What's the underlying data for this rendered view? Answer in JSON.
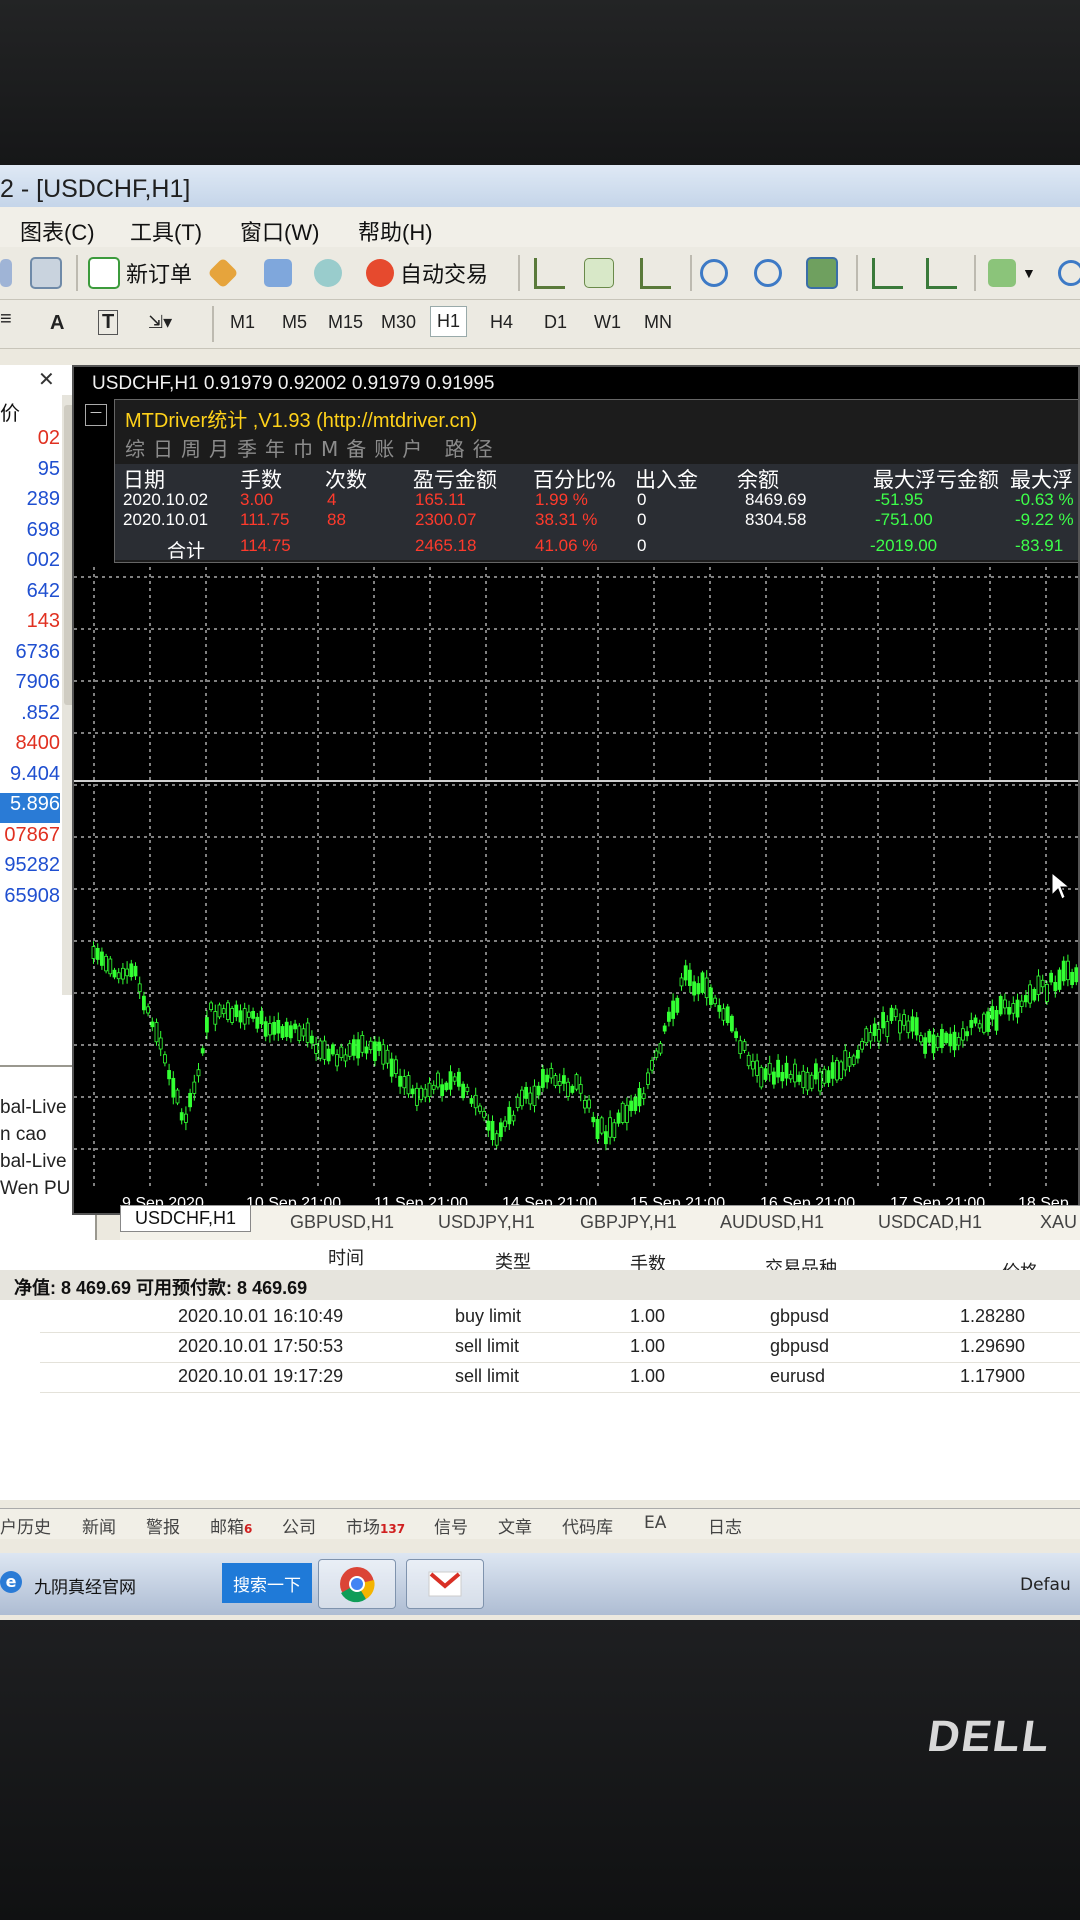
{
  "window": {
    "title": "2 - [USDCHF,H1]"
  },
  "menu": [
    "图表(C)",
    "工具(T)",
    "窗口(W)",
    "帮助(H)"
  ],
  "toolbar": {
    "new_order": "新订单",
    "auto_trade": "自动交易"
  },
  "timeframes": [
    "M1",
    "M5",
    "M15",
    "M30",
    "H1",
    "H4",
    "D1",
    "W1",
    "MN"
  ],
  "timeframe_selected": "H1",
  "market_watch": {
    "header": "价",
    "prices": [
      {
        "v": "02",
        "color": "#e03020"
      },
      {
        "v": "95",
        "color": "#1f4fd0"
      },
      {
        "v": "289",
        "color": "#1f4fd0"
      },
      {
        "v": "698",
        "color": "#1f4fd0"
      },
      {
        "v": "002",
        "color": "#1f4fd0"
      },
      {
        "v": "642",
        "color": "#1f4fd0"
      },
      {
        "v": "143",
        "color": "#e03020"
      },
      {
        "v": "6736",
        "color": "#1f4fd0"
      },
      {
        "v": "7906",
        "color": "#1f4fd0"
      },
      {
        "v": ".852",
        "color": "#1f4fd0"
      },
      {
        "v": "8400",
        "color": "#e03020"
      },
      {
        "v": "9.404",
        "color": "#1f4fd0"
      },
      {
        "v": "5.896",
        "color": "#ffffff"
      },
      {
        "v": "07867",
        "color": "#e03020"
      },
      {
        "v": "95282",
        "color": "#1f4fd0"
      },
      {
        "v": "65908",
        "color": "#1f4fd0"
      }
    ]
  },
  "navigator": {
    "items": [
      "bal-Live",
      "n cao",
      "bal-Live",
      "Wen PU"
    ]
  },
  "chart": {
    "header": "USDCHF,H1  0.91979 0.92002 0.91979 0.91995",
    "x_labels": [
      "9 Sep 2020",
      "10 Sep 21:00",
      "11 Sep 21:00",
      "14 Sep 21:00",
      "15 Sep 21:00",
      "16 Sep 21:00",
      "17 Sep 21:00",
      "18 Sep"
    ],
    "candle_color": "#33ff33",
    "grid_color": "#ffffff"
  },
  "stats": {
    "title": "MTDriver统计 ,V1.93 (http://mtdriver.cn)",
    "tabs": "综日周月季年巾M备账户 路径",
    "headers": [
      "日期",
      "手数",
      "次数",
      "盈亏金额",
      "百分比%",
      "出入金",
      "余额",
      "最大浮亏金额",
      "最大浮"
    ],
    "rows": [
      {
        "date": "2020.10.02",
        "lots": "3.00",
        "count": "4",
        "pnl": "165.11",
        "pct": "1.99 %",
        "io": "0",
        "balance": "8469.69",
        "maxloss": "-51.95",
        "maxpct": "-0.63 %"
      },
      {
        "date": "2020.10.01",
        "lots": "111.75",
        "count": "88",
        "pnl": "2300.07",
        "pct": "38.31 %",
        "io": "0",
        "balance": "8304.58",
        "maxloss": "-751.00",
        "maxpct": "-9.22 %"
      }
    ],
    "total": {
      "label": "合计",
      "lots": "114.75",
      "pnl": "2465.18",
      "pct": "41.06 %",
      "io": "0",
      "maxloss": "-2019.00",
      "maxpct": "-83.91"
    }
  },
  "chart_tabs": [
    "USDCHF,H1",
    "GBPUSD,H1",
    "USDJPY,H1",
    "GBPJPY,H1",
    "AUDUSD,H1",
    "USDCAD,H1",
    "XAU"
  ],
  "terminal": {
    "col_time": "时间",
    "col_type": "类型",
    "col_lots": "手数",
    "col_symbol": "交易品种",
    "col_price": "价格",
    "summary": "净值: 8 469.69  可用预付款: 8 469.69",
    "rows": [
      {
        "time": "2020.10.01 16:10:49",
        "type": "buy limit",
        "lots": "1.00",
        "symbol": "gbpusd",
        "price": "1.28280"
      },
      {
        "time": "2020.10.01 17:50:53",
        "type": "sell limit",
        "lots": "1.00",
        "symbol": "gbpusd",
        "price": "1.29690"
      },
      {
        "time": "2020.10.01 19:17:29",
        "type": "sell limit",
        "lots": "1.00",
        "symbol": "eurusd",
        "price": "1.17900"
      }
    ]
  },
  "bottom_tabs": [
    {
      "label": "户历史"
    },
    {
      "label": "新闻"
    },
    {
      "label": "警报"
    },
    {
      "label": "邮箱",
      "badge": "6"
    },
    {
      "label": "公司"
    },
    {
      "label": "市场",
      "badge": "137"
    },
    {
      "label": "信号"
    },
    {
      "label": "文章"
    },
    {
      "label": "代码库"
    },
    {
      "label": "EA"
    },
    {
      "label": "日志"
    }
  ],
  "taskbar": {
    "site": "九阴真经官网",
    "search": "搜索一下",
    "default": "Defau"
  },
  "brand": "DELL"
}
